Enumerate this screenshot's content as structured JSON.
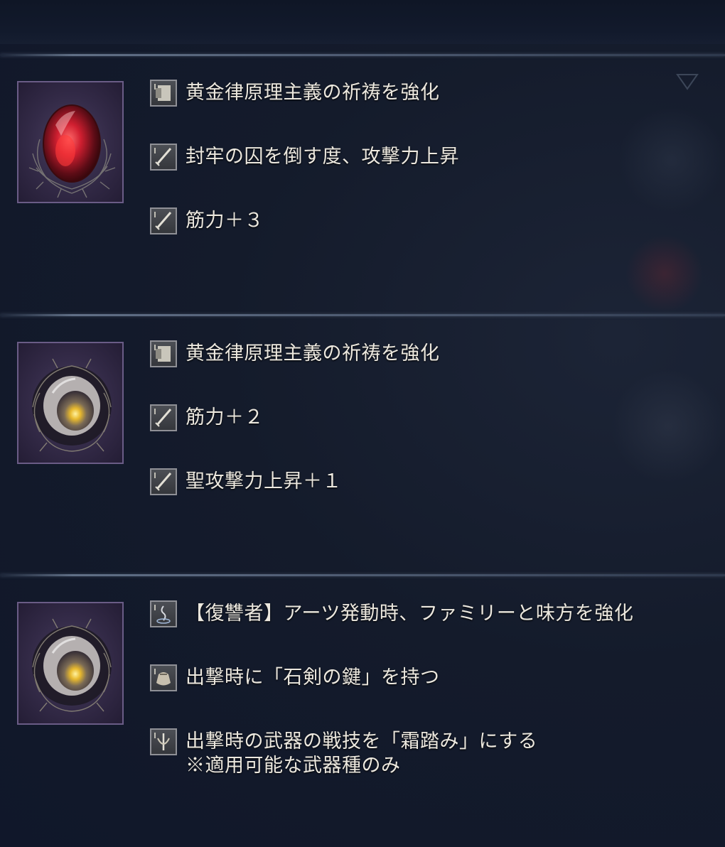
{
  "relics": [
    {
      "gem": "red-relic",
      "colors": {
        "core": "#e0263a",
        "glow": "#ff5a5a",
        "frame": "#6a5c86"
      },
      "effects": [
        {
          "icon": "incantation-icon",
          "lines": [
            "黄金律原理主義の祈祷を強化"
          ]
        },
        {
          "icon": "sword-stat-icon",
          "lines": [
            "封牢の囚を倒す度、攻撃力上昇"
          ]
        },
        {
          "icon": "sword-stat-icon",
          "lines": [
            "筋力＋３"
          ]
        }
      ]
    },
    {
      "gem": "yellow-relic",
      "colors": {
        "core": "#f0c93a",
        "glow": "#fff2a0",
        "frame": "#6a5c86"
      },
      "effects": [
        {
          "icon": "incantation-icon",
          "lines": [
            "黄金律原理主義の祈祷を強化"
          ]
        },
        {
          "icon": "sword-stat-icon",
          "lines": [
            "筋力＋２"
          ]
        },
        {
          "icon": "sword-stat-icon",
          "lines": [
            "聖攻撃力上昇＋１"
          ]
        }
      ]
    },
    {
      "gem": "yellow-relic",
      "colors": {
        "core": "#f0c93a",
        "glow": "#fff2a0",
        "frame": "#6a5c86"
      },
      "effects": [
        {
          "icon": "art-icon",
          "lines": [
            "【復讐者】アーツ発動時、ファミリーと味方を強化"
          ]
        },
        {
          "icon": "item-pouch-icon",
          "lines": [
            "出撃時に「石剣の鍵」を持つ"
          ]
        },
        {
          "icon": "weapon-skill-icon",
          "lines": [
            "出撃時の武器の戦技を「霜踏み」にする",
            "※適用可能な武器種のみ"
          ]
        }
      ]
    }
  ]
}
